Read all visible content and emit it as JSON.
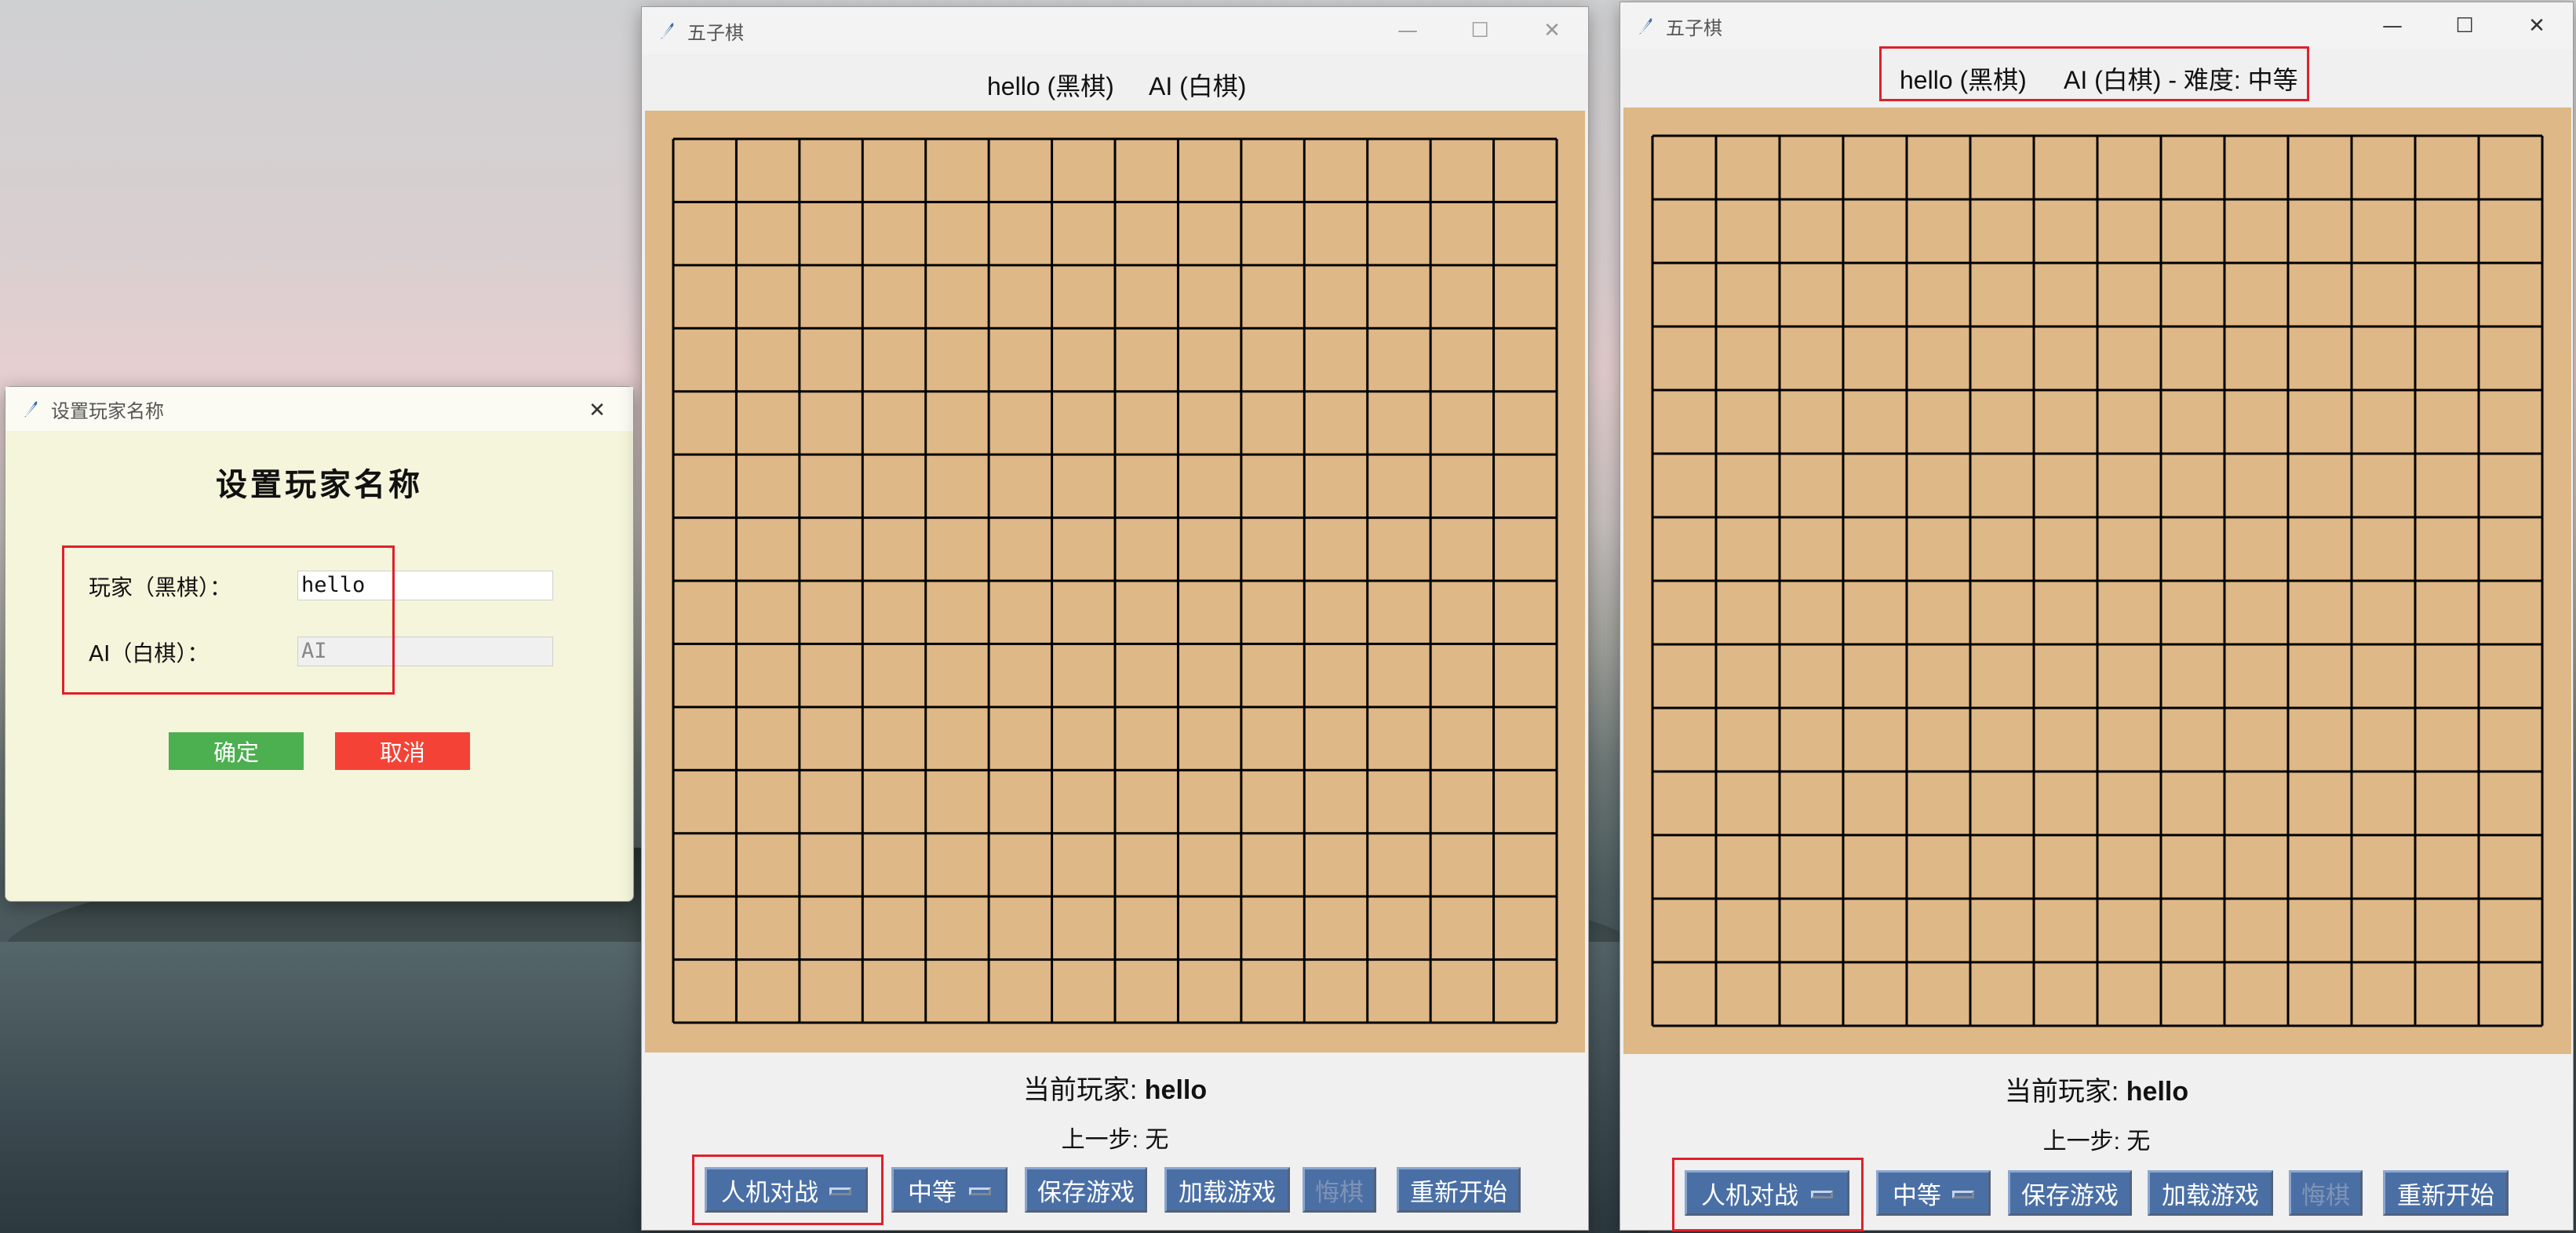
{
  "dialog": {
    "title": "设置玩家名称",
    "heading": "设置玩家名称",
    "player_label": "玩家（黑棋）：",
    "player_value": "hello",
    "ai_label": "AI（白棋）：",
    "ai_value": "AI",
    "ok_label": "确定",
    "cancel_label": "取消",
    "close_glyph": "✕",
    "colors": {
      "ok": "#4caf50",
      "cancel": "#f44336",
      "background": "#f5f5dc"
    }
  },
  "game_left": {
    "title": "五子棋",
    "player_info": "hello (黑棋)",
    "ai_info": "AI (白棋)",
    "current_player_prefix": "当前玩家: ",
    "current_player_name": "hello",
    "last_move": "上一步: 无",
    "mode_select": "人机对战",
    "difficulty_select": "中等",
    "save_label": "保存游戏",
    "load_label": "加载游戏",
    "undo_label": "悔棋",
    "restart_label": "重新开始",
    "minimize_glyph": "—",
    "maximize_glyph": "☐",
    "close_glyph": "✕"
  },
  "game_right": {
    "title": "五子棋",
    "player_info": "hello (黑棋)",
    "ai_info": "AI (白棋) - 难度: 中等",
    "current_player_prefix": "当前玩家: ",
    "current_player_name": "hello",
    "last_move": "上一步: 无",
    "mode_select": "人机对战",
    "difficulty_select": "中等",
    "save_label": "保存游戏",
    "load_label": "加载游戏",
    "undo_label": "悔棋",
    "restart_label": "重新开始",
    "minimize_glyph": "—",
    "maximize_glyph": "☐",
    "close_glyph": "✕"
  },
  "board": {
    "cells": 14,
    "colors": {
      "wood": "#deb887",
      "line": "#000000"
    }
  },
  "colors": {
    "button": "#4a6fa5",
    "highlight_box": "#e0202a"
  }
}
